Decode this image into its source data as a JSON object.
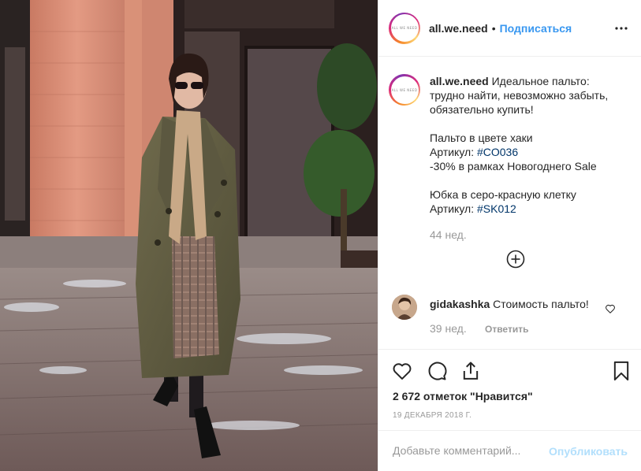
{
  "post": {
    "image": {
      "description": "photo"
    }
  },
  "header": {
    "avatar_text": "ALL WE NEED",
    "username": "all.we.need",
    "separator": "•",
    "follow_label": "Подписаться",
    "more_label": "•••"
  },
  "caption": {
    "username": "all.we.need",
    "line1": "Идеальное пальто: трудно найти, невозможно забыть, обязательно купить!",
    "line2": "Пальто в цвете хаки",
    "line3_prefix": "Артикул: ",
    "line3_tag": "#CO036",
    "line4": "-30% в рамках Новогоднего Sale",
    "line5": "Юбка в серо-красную клетку",
    "line6_prefix": "Артикул: ",
    "line6_tag": "#SK012",
    "time": "44 нед."
  },
  "comment": {
    "username": "gidakashka",
    "text": "Стоимость пальто!",
    "time": "39 нед.",
    "reply_label": "Ответить"
  },
  "actions": {
    "likes_text": "2 672 отметок \"Нравится\"",
    "date": "19 декабря 2018 г."
  },
  "add_comment": {
    "placeholder": "Добавьте комментарий...",
    "post_label": "Опубликовать"
  },
  "colors": {
    "accent": "#3897f0",
    "hashtag": "#003569",
    "muted": "#999999",
    "post_disabled": "#b2dffc"
  }
}
